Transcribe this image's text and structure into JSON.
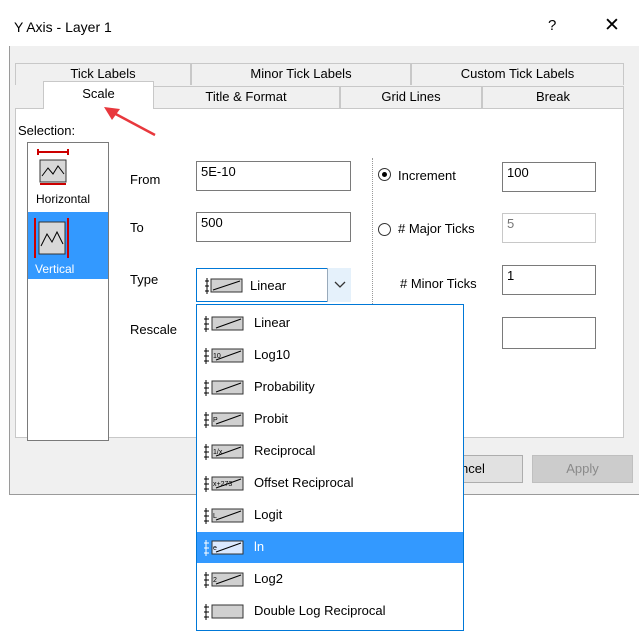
{
  "window": {
    "title": "Y Axis - Layer 1",
    "help": "?",
    "close": "✕"
  },
  "tabs": {
    "row_back": [
      "Tick Labels",
      "Minor Tick Labels",
      "Custom Tick Labels"
    ],
    "row_front": [
      "Scale",
      "Title & Format",
      "Grid Lines",
      "Break"
    ],
    "active": "Scale"
  },
  "selection": {
    "label": "Selection:",
    "items": [
      "Horizontal",
      "Vertical"
    ],
    "selected": "Vertical"
  },
  "scale": {
    "from_label": "From",
    "from_value": "5E-10",
    "to_label": "To",
    "to_value": "500",
    "type_label": "Type",
    "type_value": "Linear",
    "rescale_label": "Rescale",
    "increment_label": "Increment",
    "increment_value": "100",
    "increment_selected": true,
    "major_ticks_label": "# Major Ticks",
    "major_ticks_value": "5",
    "minor_ticks_label": "# Minor Ticks",
    "minor_ticks_value": "1",
    "extra_value": ""
  },
  "type_options": [
    "Linear",
    "Log10",
    "Probability",
    "Probit",
    "Reciprocal",
    "Offset Reciprocal",
    "Logit",
    "ln",
    "Log2",
    "Double Log Reciprocal"
  ],
  "type_options_highlighted": "ln",
  "type_icon_marks": [
    "",
    "10",
    "",
    "P",
    "1/x",
    "x+273",
    "L",
    "e",
    "2",
    ""
  ],
  "buttons": {
    "cancel": "ncel",
    "apply": "Apply"
  },
  "colors": {
    "selection_blue": "#3399ff",
    "annotation_arrow": "#e8383d",
    "focus_border": "#0078d7"
  }
}
